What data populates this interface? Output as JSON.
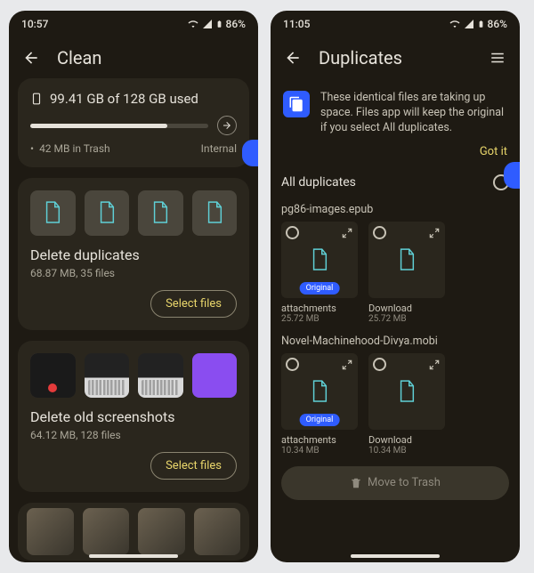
{
  "left": {
    "status": {
      "time": "10:57",
      "battery": "86%"
    },
    "title": "Clean",
    "storage": {
      "used_text": "99.41 GB of 128 GB used",
      "trash_text": "42 MB in Trash",
      "location": "Internal",
      "progress_pct": 77
    },
    "sections": [
      {
        "title": "Delete duplicates",
        "sub": "68.87 MB, 35 files",
        "button": "Select files"
      },
      {
        "title": "Delete old screenshots",
        "sub": "64.12 MB, 128 files",
        "button": "Select files"
      }
    ]
  },
  "right": {
    "status": {
      "time": "11:05",
      "battery": "86%"
    },
    "title": "Duplicates",
    "banner": {
      "text": "These identical files are taking up space. Files app will keep the original if you select All duplicates.",
      "gotit": "Got it"
    },
    "all_label": "All duplicates",
    "groups": [
      {
        "name": "pg86-images.epub",
        "items": [
          {
            "folder": "attachments",
            "size": "25.72 MB",
            "original": true
          },
          {
            "folder": "Download",
            "size": "25.72 MB",
            "original": false
          }
        ]
      },
      {
        "name": "Novel-Machinehood-Divya.mobi",
        "items": [
          {
            "folder": "attachments",
            "size": "10.34 MB",
            "original": true
          },
          {
            "folder": "Download",
            "size": "10.34 MB",
            "original": false
          }
        ]
      }
    ],
    "move_button": "Move to Trash"
  }
}
